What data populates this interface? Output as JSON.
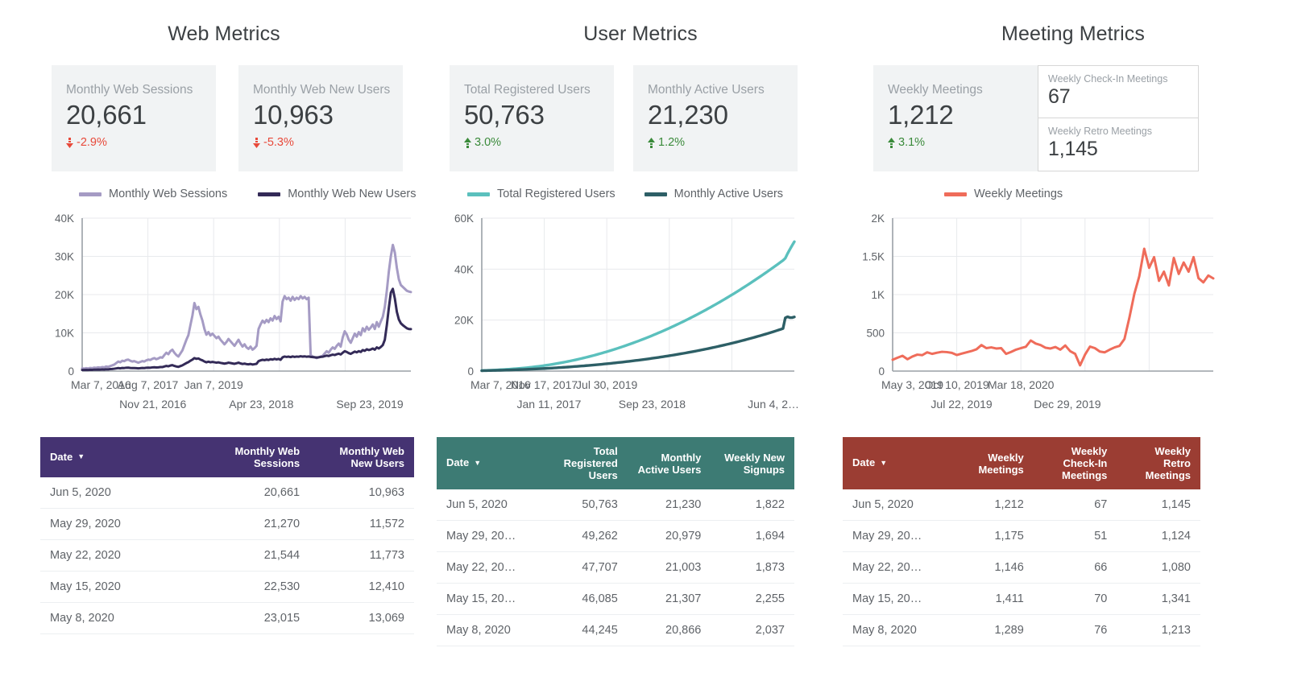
{
  "panels": [
    {
      "id": "web",
      "title": "Web Metrics",
      "header_color": "#453372",
      "kpis": [
        {
          "label": "Monthly Web Sessions",
          "value": "20,661",
          "delta": "-2.9%",
          "direction": "down"
        },
        {
          "label": "Monthly Web New Users",
          "value": "10,963",
          "delta": "-5.3%",
          "direction": "down"
        }
      ],
      "legend": [
        {
          "label": "Monthly Web Sessions",
          "color": "#a59bc4"
        },
        {
          "label": "Monthly Web New Users",
          "color": "#332a57"
        }
      ],
      "table": {
        "columns": [
          "Date",
          "Monthly Web Sessions",
          "Monthly Web New Users"
        ],
        "sort_column": "Date",
        "sort_caret": "▼",
        "rows": [
          [
            "Jun 5, 2020",
            "20,661",
            "10,963"
          ],
          [
            "May 29, 2020",
            "21,270",
            "11,572"
          ],
          [
            "May 22, 2020",
            "21,544",
            "11,773"
          ],
          [
            "May 15, 2020",
            "22,530",
            "12,410"
          ],
          [
            "May 8, 2020",
            "23,015",
            "13,069"
          ]
        ]
      }
    },
    {
      "id": "user",
      "title": "User Metrics",
      "header_color": "#3d7b74",
      "kpis": [
        {
          "label": "Total Registered Users",
          "value": "50,763",
          "delta": "3.0%",
          "direction": "up"
        },
        {
          "label": "Monthly Active Users",
          "value": "21,230",
          "delta": "1.2%",
          "direction": "up"
        }
      ],
      "legend": [
        {
          "label": "Total Registered Users",
          "color": "#5bc0bd"
        },
        {
          "label": "Monthly Active Users",
          "color": "#2d5f66"
        }
      ],
      "table": {
        "columns": [
          "Date",
          "Total Registered Users",
          "Monthly Active Users",
          "Weekly New Signups"
        ],
        "sort_column": "Date",
        "sort_caret": "▼",
        "rows": [
          [
            "Jun 5, 2020",
            "50,763",
            "21,230",
            "1,822"
          ],
          [
            "May 29, 20…",
            "49,262",
            "20,979",
            "1,694"
          ],
          [
            "May 22, 20…",
            "47,707",
            "21,003",
            "1,873"
          ],
          [
            "May 15, 20…",
            "46,085",
            "21,307",
            "2,255"
          ],
          [
            "May 8, 2020",
            "44,245",
            "20,866",
            "2,037"
          ]
        ]
      }
    },
    {
      "id": "meeting",
      "title": "Meeting Metrics",
      "header_color": "#9b3d33",
      "kpis": [
        {
          "label": "Weekly Meetings",
          "value": "1,212",
          "delta": "3.1%",
          "direction": "up"
        }
      ],
      "kpis_bordered": [
        {
          "label": "Weekly Check-In Meetings",
          "value": "67"
        },
        {
          "label": "Weekly Retro Meetings",
          "value": "1,145"
        }
      ],
      "legend": [
        {
          "label": "Weekly Meetings",
          "color": "#ef6c5a"
        }
      ],
      "table": {
        "columns": [
          "Date",
          "Weekly Meetings",
          "Weekly Check-In Meetings",
          "Weekly Retro Meetings"
        ],
        "sort_column": "Date",
        "sort_caret": "▼",
        "rows": [
          [
            "Jun 5, 2020",
            "1,212",
            "67",
            "1,145"
          ],
          [
            "May 29, 20…",
            "1,175",
            "51",
            "1,124"
          ],
          [
            "May 22, 20…",
            "1,146",
            "66",
            "1,080"
          ],
          [
            "May 15, 20…",
            "1,411",
            "70",
            "1,341"
          ],
          [
            "May 8, 2020",
            "1,289",
            "76",
            "1,213"
          ]
        ]
      }
    }
  ],
  "chart_data": [
    {
      "type": "line",
      "title": "Web Metrics",
      "xlabel": "",
      "ylabel": "",
      "ylim": [
        0,
        40000
      ],
      "yticks": [
        "0",
        "10K",
        "20K",
        "30K",
        "40K"
      ],
      "ytick_values": [
        0,
        10000,
        20000,
        30000,
        40000
      ],
      "grid": true,
      "legend_position": "top",
      "xticks_row1": [
        "Mar 7, 2016",
        "Aug 7, 2017",
        "Jan 7, 2019"
      ],
      "xticks_row2": [
        "Nov 21, 2016",
        "Apr 23, 2018",
        "Sep 23, 2019"
      ],
      "series": [
        {
          "name": "Monthly Web Sessions",
          "color": "#a59bc4",
          "values": [
            700,
            650,
            760,
            700,
            820,
            760,
            900,
            850,
            980,
            900,
            1050,
            980,
            1200,
            1100,
            1300,
            1500,
            1700,
            2100,
            2500,
            2300,
            2700,
            2600,
            2900,
            3000,
            2700,
            2500,
            2600,
            2400,
            2200,
            2400,
            2600,
            2500,
            2800,
            3000,
            2900,
            3200,
            3400,
            3100,
            3300,
            3600,
            3500,
            4200,
            4800,
            4400,
            5200,
            5600,
            4800,
            4200,
            3800,
            4600,
            5400,
            6800,
            8200,
            9400,
            12000,
            14500,
            17800,
            16200,
            16800,
            14800,
            13200,
            11000,
            9500,
            10200,
            9300,
            9800,
            9200,
            8600,
            9000,
            8200,
            7600,
            7000,
            7600,
            8400,
            7800,
            7200,
            6600,
            7400,
            8200,
            7200,
            6400,
            7000,
            6200,
            5800,
            6400,
            5600,
            6000,
            6600,
            11000,
            12200,
            13200,
            12600,
            13400,
            12800,
            13800,
            13200,
            14400,
            13600,
            14200,
            13000,
            18200,
            19600,
            18800,
            19200,
            18400,
            19400,
            18600,
            19200,
            18800,
            19600,
            19000,
            19400,
            18800,
            19200,
            4200,
            3800,
            3600,
            3400,
            3600,
            3800,
            4000,
            4600,
            5200,
            4800,
            5600,
            6200,
            5800,
            6600,
            7200,
            6400,
            8800,
            10400,
            9600,
            8200,
            7400,
            8600,
            9800,
            9000,
            10200,
            9400,
            11200,
            10400,
            11600,
            10800,
            11400,
            12200,
            11000,
            12800,
            11600,
            13000,
            14200,
            16800,
            21000,
            26000,
            30000,
            33000,
            31000,
            27000,
            24000,
            22500,
            22000,
            21500,
            21000,
            20800,
            20661
          ]
        },
        {
          "name": "Monthly Web New Users",
          "color": "#332a57",
          "values": [
            300,
            280,
            320,
            300,
            350,
            320,
            380,
            360,
            400,
            380,
            430,
            400,
            480,
            450,
            520,
            560,
            620,
            700,
            780,
            720,
            820,
            800,
            880,
            900,
            820,
            780,
            800,
            760,
            720,
            760,
            820,
            780,
            860,
            900,
            880,
            960,
            1000,
            940,
            980,
            1060,
            1040,
            1200,
            1350,
            1250,
            1450,
            1550,
            1350,
            1200,
            1100,
            1300,
            1500,
            1800,
            2100,
            2350,
            2700,
            3000,
            3400,
            3200,
            3300,
            3000,
            2800,
            2500,
            2300,
            2450,
            2300,
            2400,
            2300,
            2200,
            2280,
            2150,
            2050,
            1950,
            2050,
            2200,
            2100,
            2000,
            1900,
            2050,
            2200,
            2000,
            1850,
            1950,
            1820,
            1760,
            1860,
            1720,
            1800,
            1900,
            2600,
            2800,
            2950,
            2850,
            3000,
            2900,
            3100,
            3000,
            3200,
            3050,
            3180,
            2950,
            3600,
            3800,
            3700,
            3780,
            3650,
            3820,
            3700,
            3800,
            3750,
            3880,
            3780,
            3850,
            3750,
            3820,
            3700,
            3650,
            3600,
            3550,
            3600,
            3700,
            3750,
            3900,
            4050,
            3950,
            4150,
            4300,
            4200,
            4400,
            4550,
            4350,
            4800,
            5200,
            5000,
            4700,
            4500,
            4800,
            5100,
            4900,
            5200,
            5000,
            5500,
            5300,
            5700,
            5500,
            5650,
            5900,
            5600,
            6200,
            5900,
            6300,
            6800,
            8200,
            12000,
            16500,
            20500,
            21500,
            19000,
            15500,
            13500,
            12500,
            12000,
            11600,
            11200,
            11000,
            10963
          ]
        }
      ]
    },
    {
      "type": "line",
      "title": "User Metrics",
      "xlabel": "",
      "ylabel": "",
      "ylim": [
        0,
        60000
      ],
      "yticks": [
        "0",
        "20K",
        "40K",
        "60K"
      ],
      "ytick_values": [
        0,
        20000,
        40000,
        60000
      ],
      "grid": true,
      "legend_position": "top",
      "xticks_row1": [
        "Mar 7, 2016",
        "Nov 17, 2017",
        "Jul 30, 2019"
      ],
      "xticks_row2": [
        "Jan 11, 2017",
        "Sep 23, 2018",
        "Jun 4, 2…"
      ],
      "series": [
        {
          "name": "Total Registered Users",
          "color": "#5bc0bd",
          "values": [
            200,
            230,
            260,
            300,
            340,
            380,
            420,
            470,
            520,
            570,
            620,
            680,
            740,
            800,
            870,
            940,
            1010,
            1090,
            1170,
            1250,
            1340,
            1430,
            1530,
            1630,
            1740,
            1850,
            1970,
            2090,
            2220,
            2350,
            2490,
            2630,
            2780,
            2930,
            3090,
            3250,
            3420,
            3590,
            3770,
            3950,
            4140,
            4330,
            4530,
            4730,
            4940,
            5150,
            5370,
            5590,
            5820,
            6050,
            6290,
            6530,
            6780,
            7030,
            7290,
            7550,
            7820,
            8090,
            8370,
            8650,
            8940,
            9230,
            9530,
            9830,
            10140,
            10450,
            10770,
            11090,
            11420,
            11750,
            12090,
            12430,
            12780,
            13130,
            13490,
            13850,
            14220,
            14590,
            14970,
            15350,
            15740,
            16130,
            16530,
            16930,
            17340,
            17750,
            18170,
            18590,
            19020,
            19450,
            19890,
            20330,
            20780,
            21230,
            21690,
            22150,
            22620,
            23090,
            23570,
            24050,
            24540,
            25030,
            25530,
            26030,
            26540,
            27050,
            27570,
            28090,
            28620,
            29150,
            29690,
            30230,
            30780,
            31330,
            31890,
            32450,
            33020,
            33590,
            34170,
            34750,
            35340,
            35930,
            36530,
            37130,
            37740,
            38350,
            38970,
            39590,
            40220,
            40850,
            41490,
            42130,
            42780,
            43430,
            44245,
            46085,
            47707,
            49262,
            50763
          ]
        },
        {
          "name": "Monthly Active Users",
          "color": "#2d5f66",
          "values": [
            150,
            170,
            190,
            210,
            230,
            250,
            270,
            300,
            320,
            350,
            380,
            400,
            430,
            460,
            490,
            520,
            550,
            590,
            620,
            660,
            690,
            730,
            770,
            810,
            850,
            900,
            940,
            990,
            1030,
            1080,
            1130,
            1180,
            1240,
            1290,
            1350,
            1400,
            1460,
            1520,
            1580,
            1650,
            1710,
            1780,
            1840,
            1910,
            1980,
            2050,
            2130,
            2200,
            2280,
            2350,
            2430,
            2510,
            2600,
            2680,
            2770,
            2850,
            2940,
            3030,
            3130,
            3220,
            3320,
            3410,
            3510,
            3610,
            3720,
            3820,
            3930,
            4030,
            4150,
            4260,
            4370,
            4490,
            4610,
            4730,
            4850,
            4980,
            5100,
            5230,
            5360,
            5500,
            5630,
            5770,
            5910,
            6050,
            6200,
            6340,
            6490,
            6640,
            6800,
            6950,
            7110,
            7270,
            7430,
            7600,
            7770,
            7940,
            8110,
            8290,
            8470,
            8650,
            8830,
            9020,
            9210,
            9400,
            9600,
            9800,
            10000,
            10200,
            10410,
            10620,
            10830,
            11050,
            11270,
            11490,
            11720,
            11950,
            12180,
            12420,
            12660,
            12900,
            13150,
            13400,
            13650,
            13910,
            14170,
            14430,
            14700,
            14970,
            15250,
            15530,
            15810,
            16100,
            16390,
            16690,
            20866,
            21307,
            21003,
            20979,
            21230
          ]
        }
      ]
    },
    {
      "type": "line",
      "title": "Meeting Metrics",
      "xlabel": "",
      "ylabel": "",
      "ylim": [
        0,
        2000
      ],
      "yticks": [
        "0",
        "500",
        "1K",
        "1.5K",
        "2K"
      ],
      "ytick_values": [
        0,
        500,
        1000,
        1500,
        2000
      ],
      "grid": true,
      "legend_position": "top",
      "xticks_row1": [
        "May 3, 2019",
        "Oct 10, 2019",
        "Mar 18, 2020"
      ],
      "xticks_row2": [
        "Jul 22, 2019",
        "Dec 29, 2019"
      ],
      "series": [
        {
          "name": "Weekly Meetings",
          "color": "#ef6c5a",
          "values": [
            148,
            175,
            200,
            155,
            190,
            215,
            208,
            245,
            225,
            240,
            252,
            248,
            238,
            210,
            228,
            245,
            262,
            285,
            340,
            300,
            310,
            295,
            300,
            225,
            250,
            280,
            300,
            318,
            400,
            360,
            340,
            305,
            295,
            315,
            280,
            335,
            260,
            225,
            75,
            215,
            320,
            300,
            255,
            245,
            280,
            310,
            330,
            420,
            700,
            1010,
            1240,
            1600,
            1350,
            1490,
            1180,
            1300,
            1120,
            1480,
            1270,
            1420,
            1300,
            1490,
            1215,
            1160,
            1250,
            1212
          ]
        }
      ]
    }
  ]
}
